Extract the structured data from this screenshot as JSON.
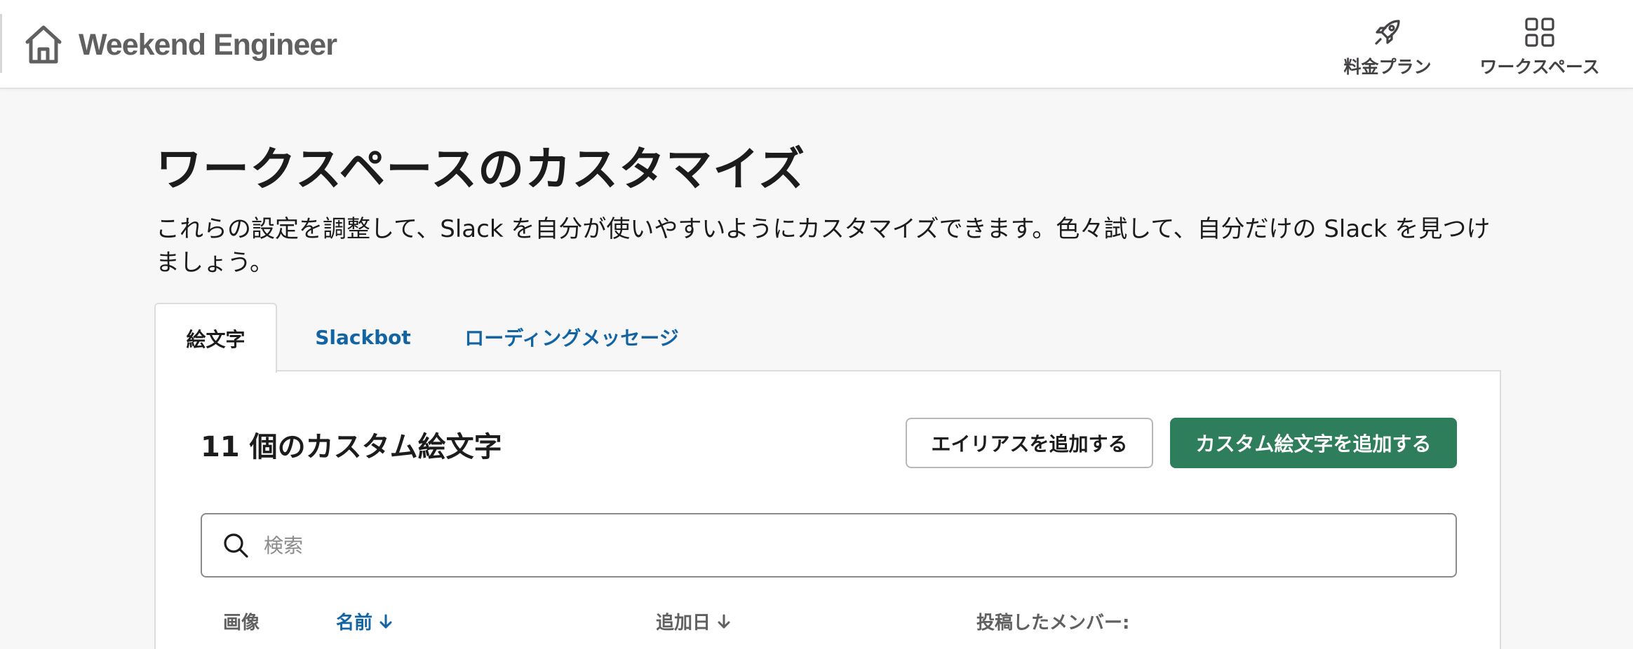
{
  "header": {
    "brand": "Weekend Engineer",
    "nav_pricing": "料金プラン",
    "nav_workspace": "ワークスペース"
  },
  "page": {
    "title": "ワークスペースのカスタマイズ",
    "description": "これらの設定を調整して、Slack を自分が使いやすいようにカスタマイズできます。色々試して、自分だけの Slack を見つけましょう。"
  },
  "tabs": [
    {
      "label": "絵文字",
      "active": true
    },
    {
      "label": "Slackbot",
      "active": false
    },
    {
      "label": "ローディングメッセージ",
      "active": false
    }
  ],
  "emoji_panel": {
    "count_title": "11 個のカスタム絵文字",
    "add_alias_label": "エイリアスを追加する",
    "add_emoji_label": "カスタム絵文字を追加する",
    "search_placeholder": "検索",
    "columns": {
      "image": "画像",
      "name": "名前",
      "added": "追加日",
      "member": "投稿したメンバー:"
    }
  },
  "colors": {
    "primary_button": "#2e7d5b",
    "link": "#1264a3"
  },
  "icons": {
    "brand": "home-icon",
    "pricing": "rocket-icon",
    "workspace": "grid-icon",
    "search": "search-icon",
    "sort": "arrow-down-icon"
  }
}
